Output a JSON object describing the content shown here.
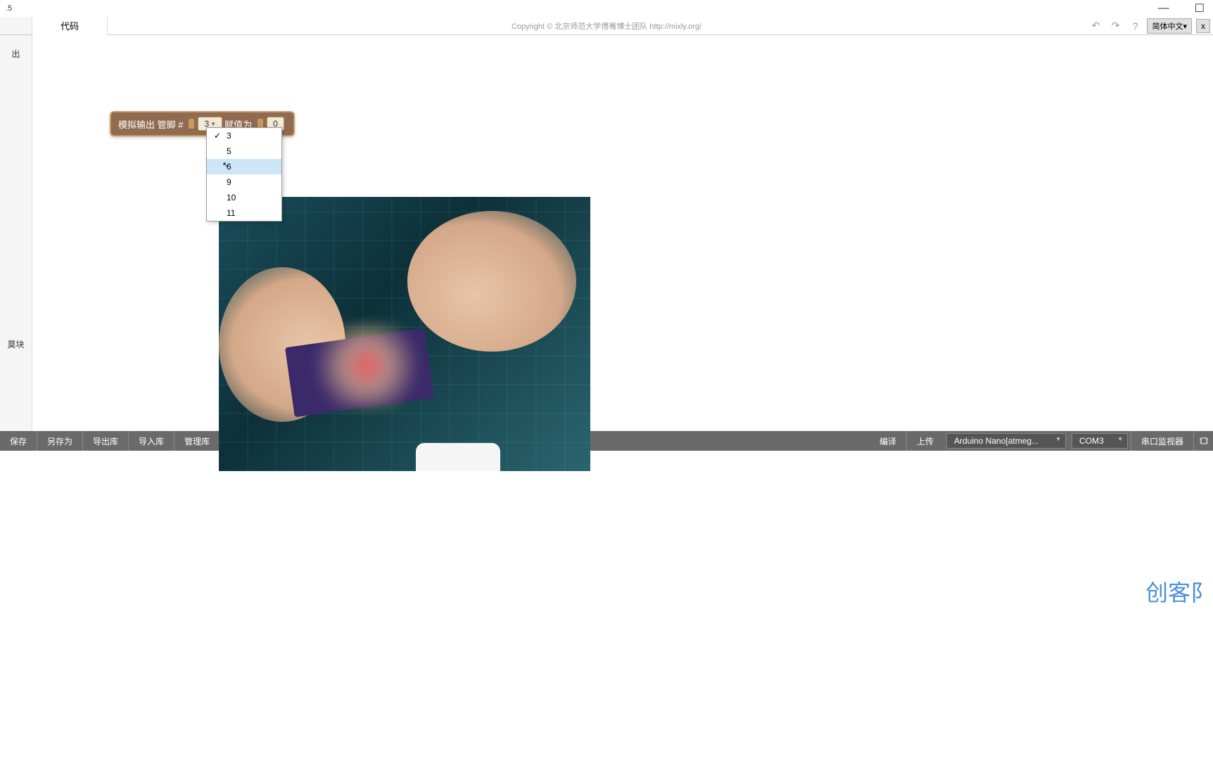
{
  "titleBar": {
    "version": ".5"
  },
  "topToolbar": {
    "tab": "代码",
    "copyright": "Copyright © 北京师范大学傅骞博士团队 http://mixly.org/",
    "langSelect": "简体中文▾",
    "closeX": "x"
  },
  "sidebar": {
    "topLabel": "出",
    "bottomLabel": "莫块"
  },
  "block": {
    "label1": "模拟输出 管脚 #",
    "pinValue": "3",
    "label2": "赋值为",
    "valueField": "0"
  },
  "dropdown": {
    "items": [
      {
        "value": "3",
        "selected": true,
        "hover": false
      },
      {
        "value": "5",
        "selected": false,
        "hover": false
      },
      {
        "value": "6",
        "selected": false,
        "hover": true
      },
      {
        "value": "9",
        "selected": false,
        "hover": false
      },
      {
        "value": "10",
        "selected": false,
        "hover": false
      },
      {
        "value": "11",
        "selected": false,
        "hover": false
      }
    ]
  },
  "bottomToolbar": {
    "save": "保存",
    "saveAs": "另存为",
    "exportLib": "导出库",
    "importLib": "导入库",
    "manageLib": "管理库",
    "compile": "编译",
    "upload": "上传",
    "board": "Arduino Nano[atmeg...",
    "port": "COM3",
    "serialMonitor": "串口监视器"
  },
  "watermark": "创客阝"
}
